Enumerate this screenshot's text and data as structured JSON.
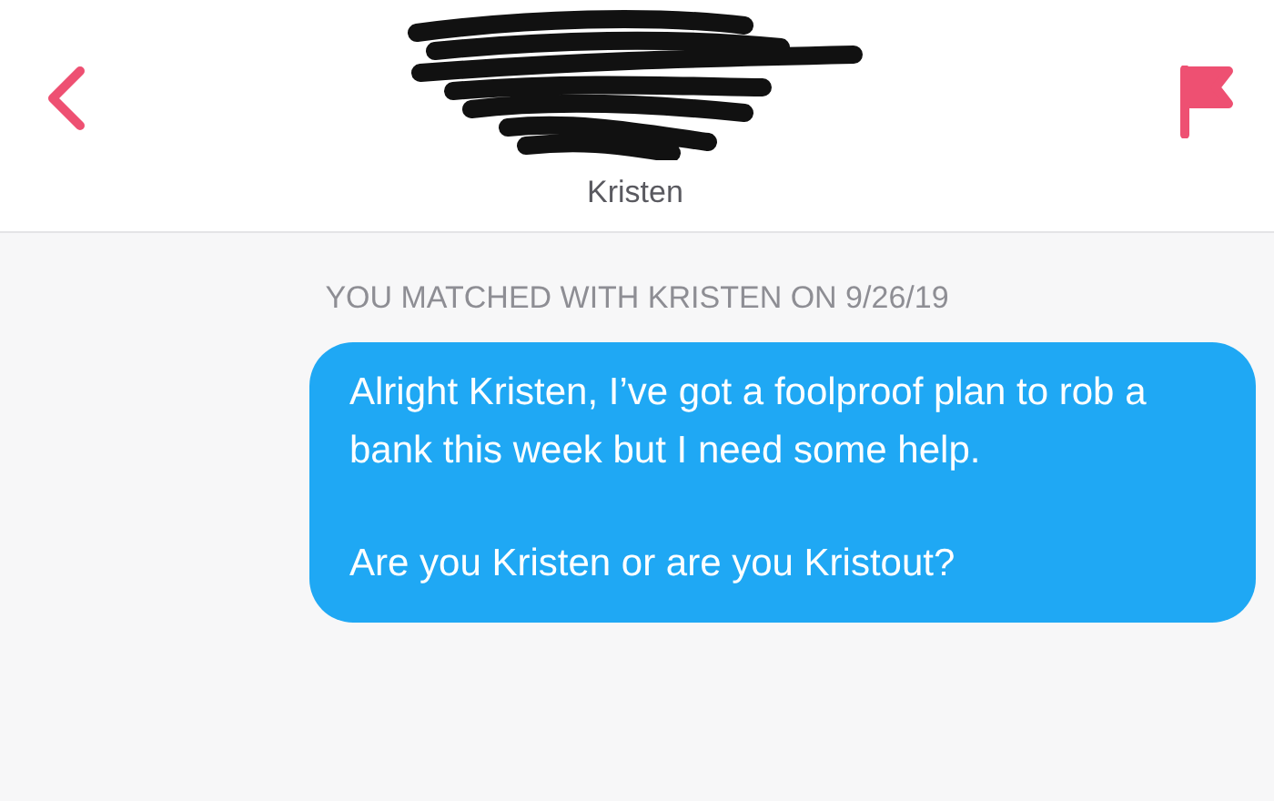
{
  "header": {
    "name": "Kristen"
  },
  "match_notice": "YOU MATCHED WITH KRISTEN ON 9/26/19",
  "messages": [
    {
      "kind": "sent",
      "paragraphs": [
        "Alright Kristen, I’ve got a foolproof plan to rob a bank this week but I need some help.",
        "Are you Kristen or are you Kristout?"
      ]
    }
  ]
}
